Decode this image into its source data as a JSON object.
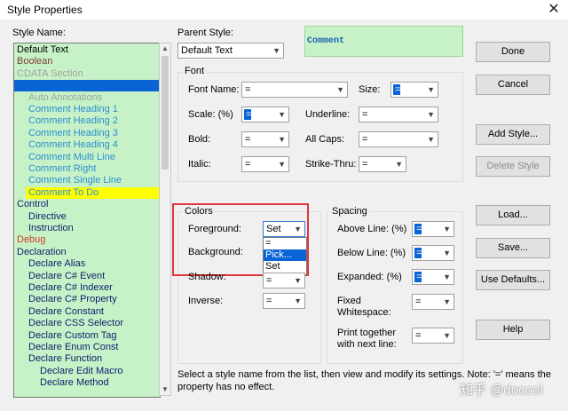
{
  "window": {
    "title": "Style Properties",
    "close_glyph": "✕"
  },
  "style_name": {
    "label": "Style Name:",
    "items": [
      {
        "label": "Default Text",
        "color": "#000000",
        "indent": 0
      },
      {
        "label": "Boolean",
        "color": "#7a3a3a",
        "indent": 0
      },
      {
        "label": "CDATA Section",
        "color": "#a0a0a0",
        "indent": 0
      },
      {
        "label": "",
        "color": "#ffffff",
        "indent": 0,
        "selected": true
      },
      {
        "label": "Auto Annotations",
        "color": "#9aa6a0",
        "indent": 1
      },
      {
        "label": "Comment Heading 1",
        "color": "#2b8fd4",
        "indent": 1
      },
      {
        "label": "Comment Heading 2",
        "color": "#2b8fd4",
        "indent": 1
      },
      {
        "label": "Comment Heading 3",
        "color": "#2b8fd4",
        "indent": 1
      },
      {
        "label": "Comment Heading 4",
        "color": "#2b8fd4",
        "indent": 1
      },
      {
        "label": "Comment Multi Line",
        "color": "#2b8fd4",
        "indent": 1
      },
      {
        "label": "Comment Right",
        "color": "#2b8fd4",
        "indent": 1
      },
      {
        "label": "Comment Single Line",
        "color": "#2b8fd4",
        "indent": 1
      },
      {
        "label": "Comment To Do",
        "color": "#2b8fd4",
        "indent": 1,
        "highlight": "#ffff00"
      },
      {
        "label": "Control",
        "color": "#0b1f6e",
        "indent": 0
      },
      {
        "label": "Directive",
        "color": "#0b1f6e",
        "indent": 1
      },
      {
        "label": "Instruction",
        "color": "#0b1f6e",
        "indent": 1
      },
      {
        "label": "Debug",
        "color": "#cc3b1f",
        "indent": 0
      },
      {
        "label": "Declaration",
        "color": "#0b1f6e",
        "indent": 0
      },
      {
        "label": "Declare Alias",
        "color": "#0b1f6e",
        "indent": 1
      },
      {
        "label": "Declare C# Event",
        "color": "#0b1f6e",
        "indent": 1
      },
      {
        "label": "Declare C# Indexer",
        "color": "#0b1f6e",
        "indent": 1
      },
      {
        "label": "Declare C# Property",
        "color": "#0b1f6e",
        "indent": 1
      },
      {
        "label": "Declare Constant",
        "color": "#0b1f6e",
        "indent": 1
      },
      {
        "label": "Declare CSS Selector",
        "color": "#0b1f6e",
        "indent": 1
      },
      {
        "label": "Declare Custom Tag",
        "color": "#0b1f6e",
        "indent": 1
      },
      {
        "label": "Declare Enum Const",
        "color": "#0b1f6e",
        "indent": 1
      },
      {
        "label": "Declare Function",
        "color": "#0b1f6e",
        "indent": 1
      },
      {
        "label": "Declare Edit Macro",
        "color": "#0b1f6e",
        "indent": 2
      },
      {
        "label": "Declare Method",
        "color": "#0b1f6e",
        "indent": 2
      }
    ]
  },
  "parent_style": {
    "label": "Parent Style:",
    "value": "Default Text"
  },
  "preview": {
    "text": "Comment",
    "bg": "#c7f2c7",
    "fg": "#1a5fb4"
  },
  "font": {
    "group_label": "Font",
    "font_name": {
      "label": "Font Name:",
      "value": "="
    },
    "size": {
      "label": "Size:",
      "value": "="
    },
    "scale": {
      "label": "Scale: (%)",
      "value": "="
    },
    "underline": {
      "label": "Underline:",
      "value": "="
    },
    "bold": {
      "label": "Bold:",
      "value": "="
    },
    "all_caps": {
      "label": "All Caps:",
      "value": "="
    },
    "italic": {
      "label": "Italic:",
      "value": "="
    },
    "strike_thru": {
      "label": "Strike-Thru:",
      "value": "="
    }
  },
  "colors": {
    "group_label": "Colors",
    "foreground": {
      "label": "Foreground:",
      "value": "Set",
      "options": [
        "=",
        "Pick...",
        "Set"
      ]
    },
    "background": {
      "label": "Background:",
      "value": "="
    },
    "shadow": {
      "label": "Shadow:",
      "value": "="
    },
    "inverse": {
      "label": "Inverse:",
      "value": "="
    }
  },
  "spacing": {
    "group_label": "Spacing",
    "above_line": {
      "label": "Above Line: (%)",
      "value": "="
    },
    "below_line": {
      "label": "Below Line: (%)",
      "value": "="
    },
    "expanded": {
      "label": "Expanded: (%)",
      "value": "="
    },
    "fixed_whitespace": {
      "label_1": "Fixed",
      "label_2": "Whitespace:",
      "value": "="
    },
    "print_together": {
      "label_1": "Print together",
      "label_2": "with next line:",
      "value": "="
    }
  },
  "buttons": {
    "done": "Done",
    "cancel": "Cancel",
    "add_style": "Add Style...",
    "delete_style": "Delete Style",
    "load": "Load...",
    "save": "Save...",
    "use_defaults": "Use Defaults...",
    "help": "Help"
  },
  "hint": {
    "line1": "Select a style name from the list, then view and modify its settings. Note: '=' means the",
    "line2": "property has no effect."
  },
  "watermark": "知乎 @docool",
  "colors_theme": {
    "selection": "#0a64d6",
    "highlight_box": "#e0353a"
  }
}
